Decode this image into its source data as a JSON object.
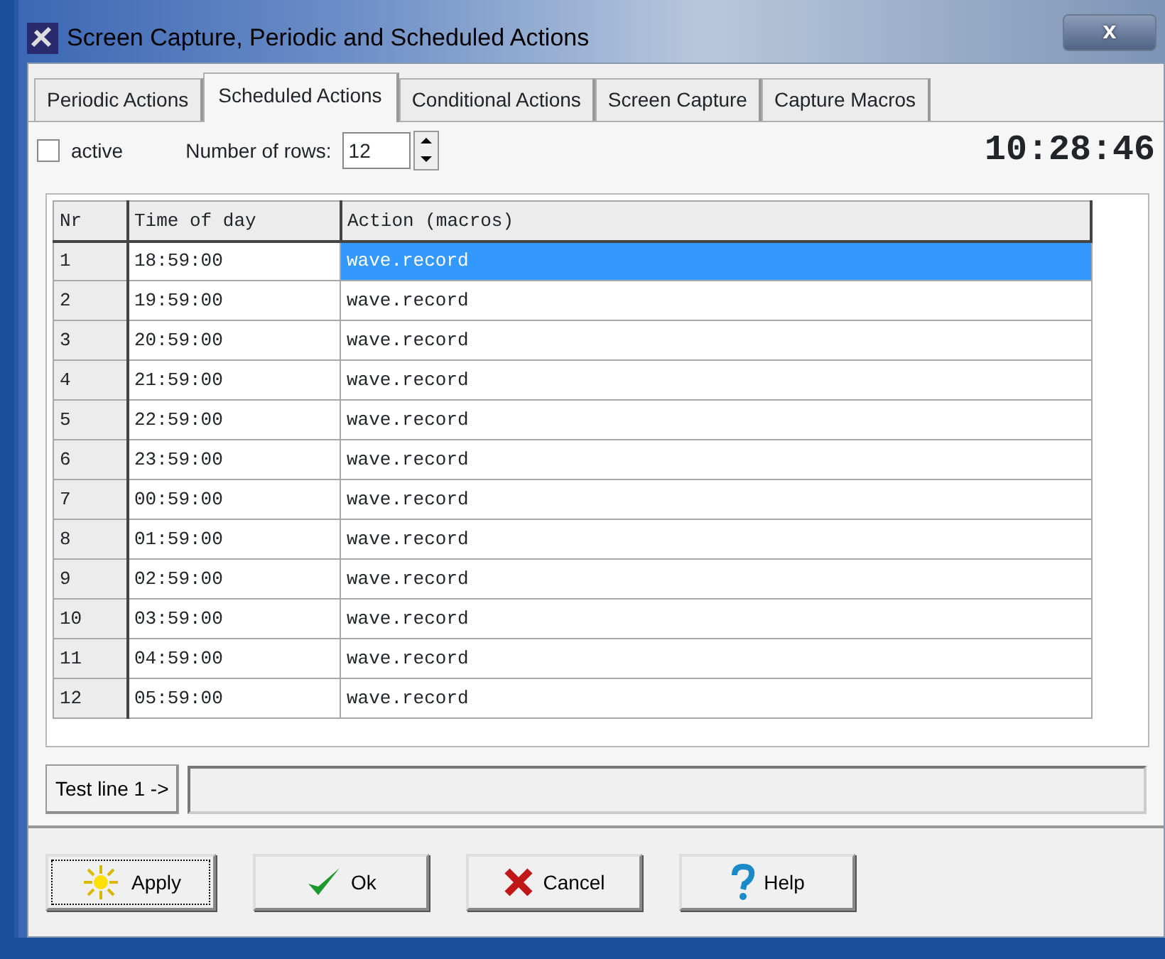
{
  "window": {
    "title": "Screen Capture, Periodic and Scheduled Actions",
    "close": "x"
  },
  "tabs": [
    {
      "label": "Periodic Actions",
      "selected": false
    },
    {
      "label": "Scheduled Actions",
      "selected": true
    },
    {
      "label": "Conditional Actions",
      "selected": false
    },
    {
      "label": "Screen Capture",
      "selected": false
    },
    {
      "label": "Capture Macros",
      "selected": false
    }
  ],
  "active": {
    "label": "active",
    "checked": false
  },
  "rows_count": {
    "label": "Number of rows:",
    "value": "12"
  },
  "clock": "10:28:46",
  "table": {
    "columns": [
      "Nr",
      "Time of day",
      "Action (macros)"
    ],
    "rows": [
      {
        "cells": [
          "1",
          "18:59:00",
          "wave.record"
        ],
        "selected": true
      },
      {
        "cells": [
          "2",
          "19:59:00",
          "wave.record"
        ],
        "selected": false
      },
      {
        "cells": [
          "3",
          "20:59:00",
          "wave.record"
        ],
        "selected": false
      },
      {
        "cells": [
          "4",
          "21:59:00",
          "wave.record"
        ],
        "selected": false
      },
      {
        "cells": [
          "5",
          "22:59:00",
          "wave.record"
        ],
        "selected": false
      },
      {
        "cells": [
          "6",
          "23:59:00",
          "wave.record"
        ],
        "selected": false
      },
      {
        "cells": [
          "7",
          "00:59:00",
          "wave.record"
        ],
        "selected": false
      },
      {
        "cells": [
          "8",
          "01:59:00",
          "wave.record"
        ],
        "selected": false
      },
      {
        "cells": [
          "9",
          "02:59:00",
          "wave.record"
        ],
        "selected": false
      },
      {
        "cells": [
          "10",
          "03:59:00",
          "wave.record"
        ],
        "selected": false
      },
      {
        "cells": [
          "11",
          "04:59:00",
          "wave.record"
        ],
        "selected": false
      },
      {
        "cells": [
          "12",
          "05:59:00",
          "wave.record"
        ],
        "selected": false
      }
    ]
  },
  "test_line": {
    "label": "Test line 1 ->"
  },
  "buttons": [
    {
      "label": "Apply",
      "kind": "apply",
      "focused": true
    },
    {
      "label": "Ok",
      "kind": "ok",
      "focused": false
    },
    {
      "label": "Cancel",
      "kind": "cancel",
      "focused": false
    },
    {
      "label": "Help",
      "kind": "help",
      "focused": false
    }
  ]
}
